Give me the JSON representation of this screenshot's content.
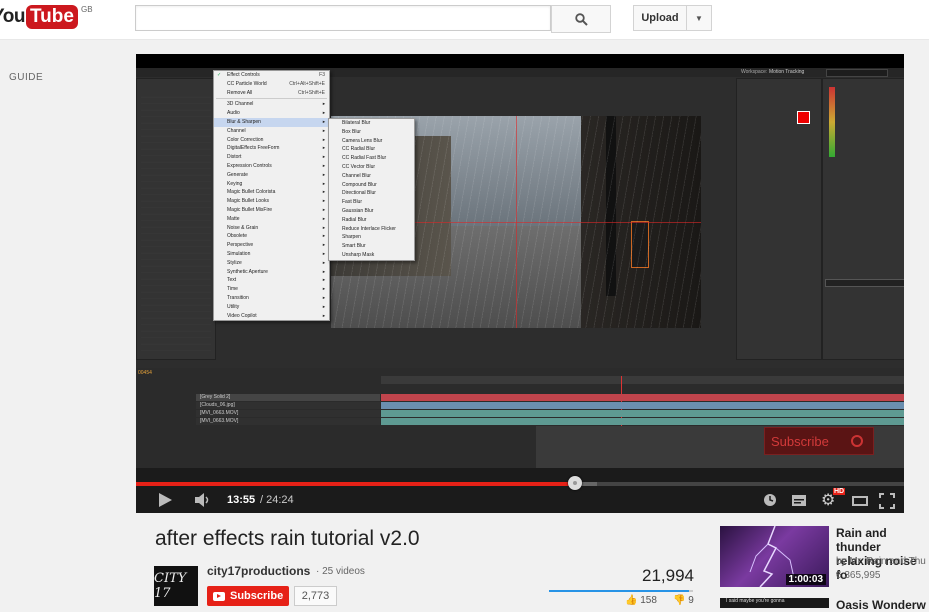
{
  "masthead": {
    "logo_you": "You",
    "logo_tube": "Tube",
    "region": "GB",
    "search_placeholder": "",
    "upload_label": "Upload"
  },
  "guide_label": "GUIDE",
  "ae": {
    "effects_menu": [
      {
        "label": "Effect Controls",
        "shortcut": "F3",
        "checked": true
      },
      {
        "label": "CC Particle World",
        "shortcut": "Ctrl+Alt+Shift+E"
      },
      {
        "label": "Remove All",
        "shortcut": "Ctrl+Shift+E"
      },
      {
        "label": "3D Channel",
        "sub": true
      },
      {
        "label": "Audio",
        "sub": true
      },
      {
        "label": "Blur & Sharpen",
        "sub": true,
        "highlight": true
      },
      {
        "label": "Channel",
        "sub": true
      },
      {
        "label": "Color Correction",
        "sub": true
      },
      {
        "label": "DigitalEffects FreeForm",
        "sub": true
      },
      {
        "label": "Distort",
        "sub": true
      },
      {
        "label": "Expression Controls",
        "sub": true
      },
      {
        "label": "Generate",
        "sub": true
      },
      {
        "label": "Keying",
        "sub": true
      },
      {
        "label": "Magic Bullet Colorista",
        "sub": true
      },
      {
        "label": "Magic Bullet Looks",
        "sub": true
      },
      {
        "label": "Magic Bullet MisFire",
        "sub": true
      },
      {
        "label": "Matte",
        "sub": true
      },
      {
        "label": "Noise & Grain",
        "sub": true
      },
      {
        "label": "Obsolete",
        "sub": true
      },
      {
        "label": "Perspective",
        "sub": true
      },
      {
        "label": "Simulation",
        "sub": true
      },
      {
        "label": "Stylize",
        "sub": true
      },
      {
        "label": "Synthetic Aperture",
        "sub": true
      },
      {
        "label": "Text",
        "sub": true
      },
      {
        "label": "Time",
        "sub": true
      },
      {
        "label": "Transition",
        "sub": true
      },
      {
        "label": "Utility",
        "sub": true
      },
      {
        "label": "Video Copilot",
        "sub": true
      }
    ],
    "blur_submenu": [
      "Bilateral Blur",
      "Box Blur",
      "Camera Lens Blur",
      "CC Radial Blur",
      "CC Radial Fast Blur",
      "CC Vector Blur",
      "Channel Blur",
      "Compound Blur",
      "Directional Blur",
      "Fast Blur",
      "Gaussian Blur",
      "Radial Blur",
      "Reduce Interlace Flicker",
      "Sharpen",
      "Smart Blur",
      "Unsharp Mask"
    ],
    "layers": [
      "[Grey Solid 2]",
      "[Clouds_06.jpg]",
      "[MVI_0663.MOV]",
      "[MVI_0663.MOV]"
    ],
    "timecode": "00454",
    "workspace": "Motion Tracking",
    "subscribe_overlay": "Subscribe"
  },
  "player": {
    "current_time": "13:55",
    "duration": "24:24",
    "progress_fraction": 0.571,
    "buffered_fraction": 0.6,
    "hd_badge": "HD"
  },
  "video": {
    "title": "after effects rain tutorial v2.0",
    "avatar_text": "CITY 17",
    "channel": "city17productions",
    "video_count": "· 25 videos",
    "subscribe_label": "Subscribe",
    "subscriber_count": "2,773",
    "views": "21,994",
    "likes": "158",
    "dislikes": "9"
  },
  "recommended": [
    {
      "title": "Rain and thunder relaxing noise fo",
      "by": "by Mr. Rain and Thu",
      "views": "6,365,995",
      "duration": "1:00:03"
    },
    {
      "title": "Oasis Wonderw",
      "thumb_text": "I said maybe you're gonna"
    }
  ]
}
